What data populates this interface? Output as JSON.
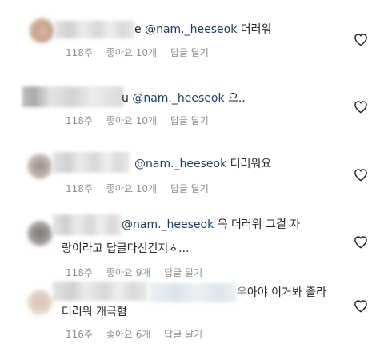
{
  "comments": [
    {
      "name_tail": "e",
      "mention": "@nam._heeseok",
      "text": "더러워",
      "line2": "",
      "time": "118주",
      "likes": "좋아요 10개",
      "reply": "답글 달기",
      "like_icon": "heart-outline-icon"
    },
    {
      "name_tail": "u",
      "mention": "@nam._heeseok",
      "text": "으..",
      "line2": "",
      "time": "118주",
      "likes": "좋아요 10개",
      "reply": "답글 달기",
      "like_icon": "heart-outline-icon"
    },
    {
      "name_tail": "",
      "mention": "@nam._heeseok",
      "text": "더러워요",
      "line2": "",
      "time": "118주",
      "likes": "좋아요 10개",
      "reply": "답글 달기",
      "like_icon": "heart-outline-icon"
    },
    {
      "name_tail": "",
      "mention": "@nam._heeseok",
      "text": "윽 더러워 그걸 자",
      "line2": "랑이라고 답글다신건지ㅎ...",
      "time": "118주",
      "likes": "좋아요 9개",
      "reply": "답글 달기",
      "like_icon": "heart-outline-icon"
    },
    {
      "name_tail": "",
      "mention": "",
      "text": "아야 이거봐 졸라",
      "text_prefix": "우",
      "line2": "더러워 개극혐",
      "time": "116주",
      "likes": "좋아요 6개",
      "reply": "답글 달기",
      "like_icon": "heart-outline-icon"
    }
  ],
  "colors": {
    "text": "#262626",
    "meta": "#8e8e8e",
    "mention": "#1f3a5f",
    "heart": "#262626"
  }
}
